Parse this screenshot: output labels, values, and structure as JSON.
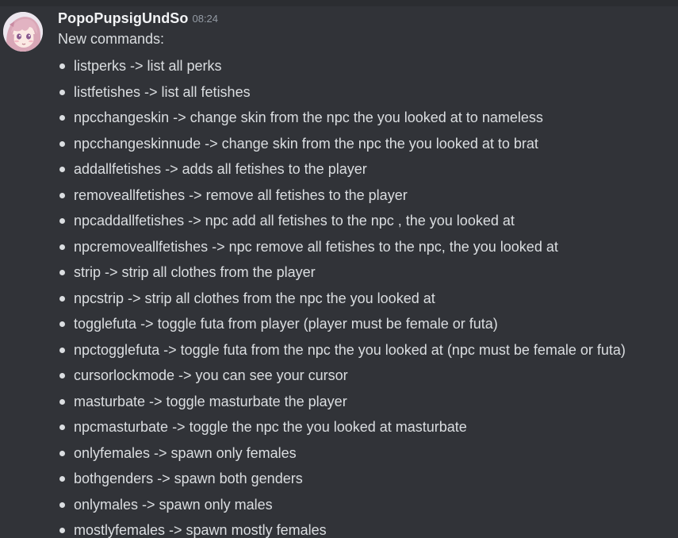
{
  "message": {
    "username": "PopoPupsigUndSo",
    "timestamp": "08:24",
    "intro": "New commands:",
    "commands": [
      "listperks -> list all perks",
      "listfetishes -> list all fetishes",
      "npcchangeskin -> change skin from the npc the you looked at to nameless",
      "npcchangeskinnude -> change skin from the npc the you looked at to brat",
      "addallfetishes -> adds all fetishes to the player",
      "removeallfetishes -> remove all fetishes to the player",
      "npcaddallfetishes -> npc add all fetishes to the npc , the you looked at",
      "npcremoveallfetishes -> npc remove all fetishes to the npc, the you looked at",
      "strip -> strip all clothes from the player",
      "npcstrip -> strip all clothes from the npc the you looked at",
      "togglefuta -> toggle futa from player (player must be female or futa)",
      "npctogglefuta -> toggle futa from the npc the you looked at (npc must be female or futa)",
      "cursorlockmode -> you can see your cursor",
      "masturbate -> toggle masturbate the player",
      "npcmasturbate -> toggle the npc the you looked at masturbate",
      "onlyfemales -> spawn only females",
      "bothgenders -> spawn both genders",
      "onlymales -> spawn only males",
      "mostlyfemales -> spawn mostly females"
    ]
  },
  "colors": {
    "background": "#313338",
    "username": "#f2f3f5",
    "text": "#dbdee1",
    "timestamp": "#949ba4"
  },
  "icons": {
    "avatar": "anime-avatar-pink-hair"
  }
}
